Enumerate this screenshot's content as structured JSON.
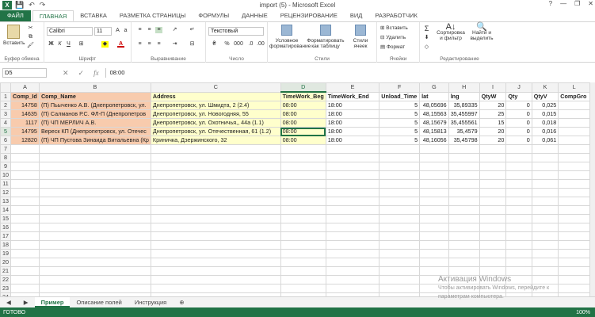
{
  "window": {
    "title": "import (5) - Microsoft Excel",
    "app_icon": "X",
    "help": "?",
    "minimize": "—",
    "restore": "❐",
    "close": "✕"
  },
  "ribbon_tabs": [
    "ФАЙЛ",
    "ГЛАВНАЯ",
    "ВСТАВКА",
    "РАЗМЕТКА СТРАНИЦЫ",
    "ФОРМУЛЫ",
    "ДАННЫЕ",
    "РЕЦЕНЗИРОВАНИЕ",
    "ВИД",
    "РАЗРАБОТЧИК"
  ],
  "ribbon": {
    "paste": "Вставить",
    "clipboard": "Буфер обмена",
    "font_name": "Calibri",
    "font_size": "11",
    "bold": "Ж",
    "italic": "К",
    "underline": "Ч",
    "font_group": "Шрифт",
    "align_group": "Выравнивание",
    "number_format": "Текстовый",
    "number_group": "Число",
    "conditional": "Условное форматирование",
    "format_table": "Форматировать как таблицу",
    "cell_styles": "Стили ячеек",
    "styles_group": "Стили",
    "insert": "Вставить",
    "delete": "Удалить",
    "format": "Формат",
    "cells_group": "Ячейки",
    "sort": "Сортировка и фильтр",
    "find": "Найти и выделить",
    "editing_group": "Редактирование",
    "sigma": "Σ",
    "percent": "%",
    "thousands": "000"
  },
  "formula_bar": {
    "name_box": "D5",
    "formula": "08:00",
    "fx": "fx"
  },
  "columns": [
    "A",
    "B",
    "C",
    "D",
    "E",
    "F",
    "G",
    "H",
    "I",
    "J",
    "K",
    "L"
  ],
  "rows": [
    [
      "Comp_Id",
      "Comp_Name",
      "Address",
      "TimeWork_Beg",
      "TimeWork_End",
      "Unload_Time",
      "lat",
      "lng",
      "QtyW",
      "Qty",
      "QtyV",
      "CompGro"
    ],
    [
      "14758",
      "(П) Пьыченко А.В. (Днепропетровск, ул.",
      "Днепропетровск, ул. Шмидта, 2  (2.4)",
      "08:00",
      "18:00",
      "5",
      "48,05696",
      "35,89335",
      "20",
      "0",
      "0,025",
      ""
    ],
    [
      "14635",
      "(П) Салманов Р.С. ФЛ-П (Днепропетров",
      "Днепропетровск, ул. Новогодняя, 55",
      "08:00",
      "18:00",
      "5",
      "48,15563",
      "35,455997",
      "25",
      "0",
      "0,015",
      ""
    ],
    [
      "1117",
      "(П) ЧП МЕРЛИЧ А.В.",
      "Днепропетровск, ул. Охотничья,, 44а  (1.1)",
      "08:00",
      "18:00",
      "5",
      "48,15679",
      "35,455561",
      "15",
      "0",
      "0,018",
      ""
    ],
    [
      "14795",
      "Вереск КП (Днепропетровск, ул. Отечес",
      "Днепропетровск, ул. Отечественная, 61  (1.2)",
      "08:00",
      "18:00",
      "5",
      "48,15813",
      "35,4579",
      "20",
      "0",
      "0,016",
      ""
    ],
    [
      "12820",
      "(П) ЧП Пустова Зинаида Витальевна (Кр",
      "Криничка, Дзержинского, 32",
      "08:00",
      "18:00",
      "5",
      "48,16056",
      "35,45798",
      "20",
      "0",
      "0,061",
      ""
    ]
  ],
  "row_numbers": [
    "1",
    "2",
    "3",
    "4",
    "5",
    "6",
    "7",
    "8",
    "9",
    "10",
    "11",
    "12",
    "13",
    "14",
    "15",
    "16",
    "17",
    "18",
    "19",
    "20",
    "21",
    "22",
    "23",
    "24"
  ],
  "sheets": [
    "Пример",
    "Описание полей",
    "Инструкция"
  ],
  "add_sheet": "⊕",
  "status": {
    "ready": "ГОТОВО",
    "zoom": "100%"
  },
  "activation": {
    "line1": "Активация Windows",
    "line2": "Чтобы активировать Windows, перейдите к",
    "line3": "параметрам компьютера."
  }
}
